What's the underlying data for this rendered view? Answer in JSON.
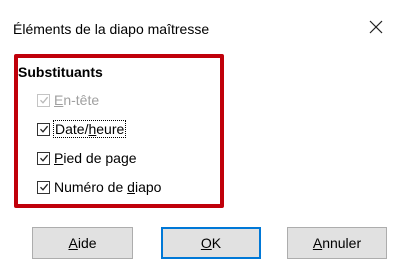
{
  "dialog": {
    "title": "Éléments de la diapo maîtresse",
    "close_glyph": "✕"
  },
  "group": {
    "label": "Substituants",
    "options": [
      {
        "pre": "",
        "mnemonic": "E",
        "post": "n-tête",
        "checked": true,
        "enabled": false
      },
      {
        "pre": "Date/",
        "mnemonic": "h",
        "post": "eure",
        "checked": true,
        "enabled": true
      },
      {
        "pre": "",
        "mnemonic": "P",
        "post": "ied de page",
        "checked": true,
        "enabled": true
      },
      {
        "pre": "Numéro de ",
        "mnemonic": "d",
        "post": "iapo",
        "checked": true,
        "enabled": true
      }
    ]
  },
  "buttons": {
    "help": {
      "mnemonic": "A",
      "post": "ide"
    },
    "ok": {
      "mnemonic": "O",
      "post": "K"
    },
    "cancel": {
      "mnemonic": "A",
      "post": "nnuler"
    }
  },
  "colors": {
    "highlight_frame": "#c0000a",
    "check": "#1f1f1f",
    "disabled_check": "#b8b8b8"
  }
}
